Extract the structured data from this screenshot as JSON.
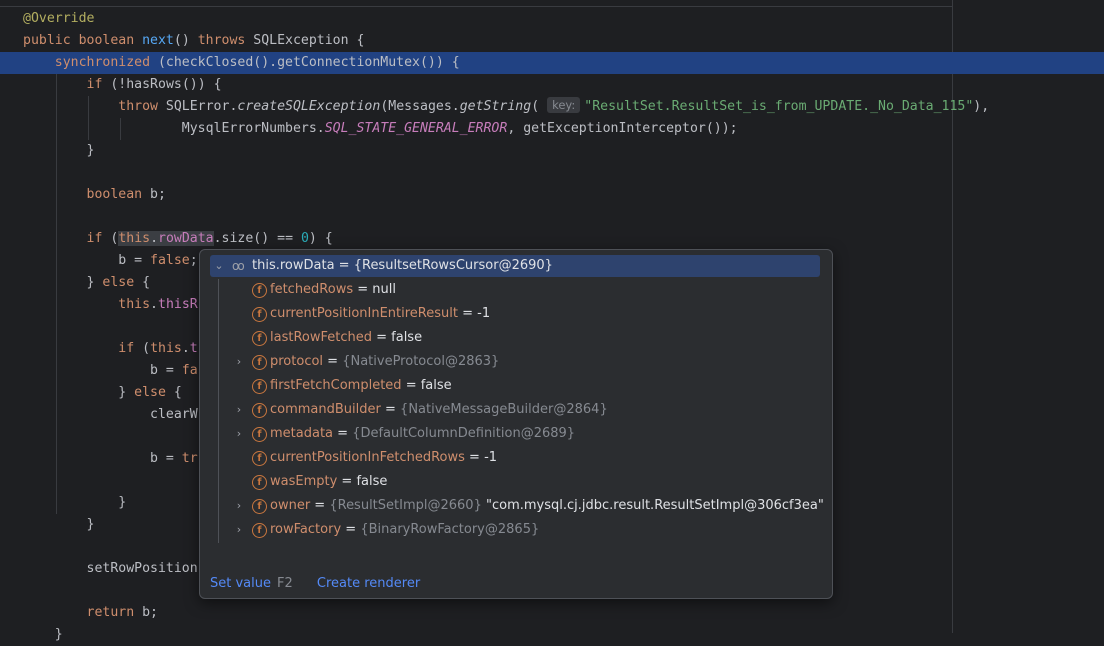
{
  "code_lines": [
    {
      "html": "<span class=\"ann\">@Override</span>"
    },
    {
      "html": "<span class=\"kw\">public boolean</span> <span class=\"fn\">next</span>() <span class=\"kw\">throws</span> SQLException {"
    },
    {
      "html": "    <span class=\"kw\">synchronized</span> (checkClosed().getConnectionMutex()) {"
    },
    {
      "html": "        <span class=\"kw\">if</span> (!hasRows()) {"
    },
    {
      "html": "            <span class=\"kw\">throw</span> SQLError.<span class=\"it\">createSQLException</span>(Messages.<span class=\"it\">getString</span>( <span class=\"hint\">key:</span><span class=\"str\">\"ResultSet.ResultSet_is_from_UPDATE._No_Data_115\"</span>),"
    },
    {
      "html": "                    MysqlErrorNumbers.<span class=\"cst\">SQL_STATE_GENERAL_ERROR</span>, getExceptionInterceptor());"
    },
    {
      "html": "        }"
    },
    {
      "html": ""
    },
    {
      "html": "        <span class=\"kw\">boolean</span> b;"
    },
    {
      "html": ""
    },
    {
      "html": "        <span class=\"kw\">if</span> (<span class=\"sel-bg\"><span class=\"kw\">this</span>.<span class=\"fld\">rowData</span></span>.size() == <span class=\"num\">0</span>) {"
    },
    {
      "html": "            b = <span class=\"kw\">false</span>;"
    },
    {
      "html": "        } <span class=\"kw\">else</span> {"
    },
    {
      "html": "            <span class=\"kw\">this</span>.<span class=\"fld\">thisR</span>"
    },
    {
      "html": ""
    },
    {
      "html": "            <span class=\"kw\">if</span> (<span class=\"kw\">this</span>.<span class=\"fld\">t</span>"
    },
    {
      "html": "                b = <span class=\"kw\">fa</span>"
    },
    {
      "html": "            } <span class=\"kw\">else</span> {"
    },
    {
      "html": "                clearW"
    },
    {
      "html": ""
    },
    {
      "html": "                b = <span class=\"kw\">tr</span>"
    },
    {
      "html": ""
    },
    {
      "html": "            }"
    },
    {
      "html": "        }"
    },
    {
      "html": ""
    },
    {
      "html": "        setRowPosition"
    },
    {
      "html": ""
    },
    {
      "html": "        <span class=\"kw\">return</span> b;"
    },
    {
      "html": "    }"
    }
  ],
  "popup": {
    "root": {
      "expr": "this.rowData",
      "eq": " = ",
      "value": "{ResultsetRowsCursor@2690}"
    },
    "fields": [
      {
        "name": "fetchedRows",
        "eq": " = ",
        "ref": "",
        "value": "null",
        "expandable": false
      },
      {
        "name": "currentPositionInEntireResult",
        "eq": " = ",
        "ref": "",
        "value": "-1",
        "expandable": false
      },
      {
        "name": "lastRowFetched",
        "eq": " = ",
        "ref": "",
        "value": "false",
        "expandable": false
      },
      {
        "name": "protocol",
        "eq": " = ",
        "ref": "{NativeProtocol@2863}",
        "value": "",
        "expandable": true
      },
      {
        "name": "firstFetchCompleted",
        "eq": " = ",
        "ref": "",
        "value": "false",
        "expandable": false
      },
      {
        "name": "commandBuilder",
        "eq": " = ",
        "ref": "{NativeMessageBuilder@2864}",
        "value": "",
        "expandable": true
      },
      {
        "name": "metadata",
        "eq": " = ",
        "ref": "{DefaultColumnDefinition@2689}",
        "value": "",
        "expandable": true
      },
      {
        "name": "currentPositionInFetchedRows",
        "eq": " = ",
        "ref": "",
        "value": "-1",
        "expandable": false
      },
      {
        "name": "wasEmpty",
        "eq": " = ",
        "ref": "",
        "value": "false",
        "expandable": false
      },
      {
        "name": "owner",
        "eq": " = ",
        "ref": "{ResultSetImpl@2660}",
        "value": "\"com.mysql.cj.jdbc.result.ResultSetImpl@306cf3ea\"",
        "expandable": true
      },
      {
        "name": "rowFactory",
        "eq": " = ",
        "ref": "{BinaryRowFactory@2865}",
        "value": "",
        "expandable": true
      }
    ],
    "field_icon": "f",
    "footer": {
      "set_value": "Set value",
      "set_value_key": "F2",
      "create_renderer": "Create renderer"
    }
  },
  "icons": {
    "expand": "chevron-right-icon",
    "collapse": "chevron-down-icon",
    "watch": "glasses-icon",
    "field": "field-icon"
  },
  "colors": {
    "background": "#1e1f22",
    "highlight_line": "#214283",
    "popup_bg": "#2b2d30",
    "link": "#548af7",
    "field_icon": "#c9773f"
  }
}
